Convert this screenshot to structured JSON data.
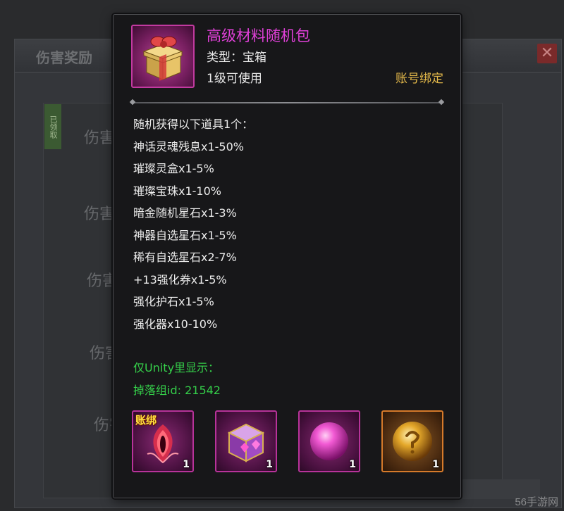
{
  "background": {
    "title": "伤害奖励",
    "close_glyph": "✕",
    "tag": "已领取",
    "rows": [
      "伤害",
      "伤害",
      "伤害",
      "伤害",
      "伤害"
    ]
  },
  "tooltip": {
    "item_name": "高级材料随机包",
    "item_type": "类型：宝箱",
    "item_level": "1级可使用",
    "item_bind": "账号绑定",
    "item_icon": "gift-box-icon",
    "description": [
      "随机获得以下道具1个：",
      "神话灵魂残息x1-50%",
      "璀璨灵盒x1-5%",
      "璀璨宝珠x1-10%",
      "暗金随机星石x1-3%",
      "神器自选星石x1-5%",
      "稀有自选星石x2-7%",
      "+13强化券x1-5%",
      "强化护石x1-5%",
      "强化器x10-10%"
    ],
    "unity_info": [
      "仅Unity里显示：",
      "掉落组id: 21542"
    ],
    "slots": [
      {
        "icon": "soul-eye-icon",
        "count": "1",
        "bound_label": "账绑",
        "frame": "purple"
      },
      {
        "icon": "jewel-box-icon",
        "count": "1",
        "bound_label": "",
        "frame": "purple"
      },
      {
        "icon": "pink-orb-icon",
        "count": "1",
        "bound_label": "",
        "frame": "purple"
      },
      {
        "icon": "golden-orb-icon",
        "count": "1",
        "bound_label": "",
        "frame": "orange"
      }
    ]
  },
  "watermark": "56手游网",
  "colors": {
    "item_name": "#e040d8",
    "bind": "#e4b94a",
    "unity_text": "#35d04a",
    "frame_purple": "#b8339a",
    "frame_orange": "#d67a2a"
  }
}
